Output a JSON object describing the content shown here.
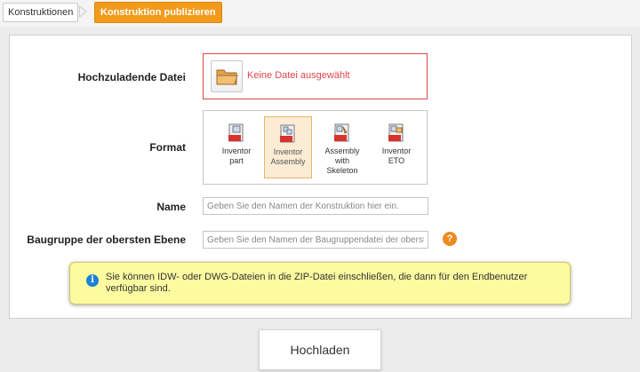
{
  "breadcrumb": {
    "parent": "Konstruktionen",
    "current": "Konstruktion publizieren"
  },
  "form": {
    "file_label": "Hochzuladende Datei",
    "file_status": "Keine Datei ausgewählt",
    "format_label": "Format",
    "formats": [
      {
        "line1": "Inventor",
        "line2": "part",
        "line3": "",
        "badge": "IPT",
        "selected": false
      },
      {
        "line1": "Inventor",
        "line2": "Assembly",
        "line3": "",
        "badge": "ZIP",
        "selected": true
      },
      {
        "line1": "Assembly",
        "line2": "with",
        "line3": "Skeleton",
        "badge": "ZIP",
        "selected": false
      },
      {
        "line1": "Inventor",
        "line2": "ETO",
        "line3": "",
        "badge": "ZIP",
        "selected": false
      }
    ],
    "name_label": "Name",
    "name_placeholder": "Geben Sie den Namen der Konstruktion hier ein.",
    "assembly_label": "Baugruppe der obersten Ebene",
    "assembly_placeholder": "Geben Sie den Namen der Baugruppendatei der obersten Ebene ein.",
    "help_glyph": "?"
  },
  "info": {
    "glyph": "i",
    "text": "Sie können IDW- oder DWG-Dateien in die ZIP-Datei einschließen, die dann für den Endbenutzer verfügbar sind."
  },
  "actions": {
    "upload_label": "Hochladen"
  },
  "colors": {
    "accent": "#f39a1b",
    "error": "#e0454b",
    "info_bg": "#fcfba0",
    "info_icon": "#1d82d6"
  }
}
